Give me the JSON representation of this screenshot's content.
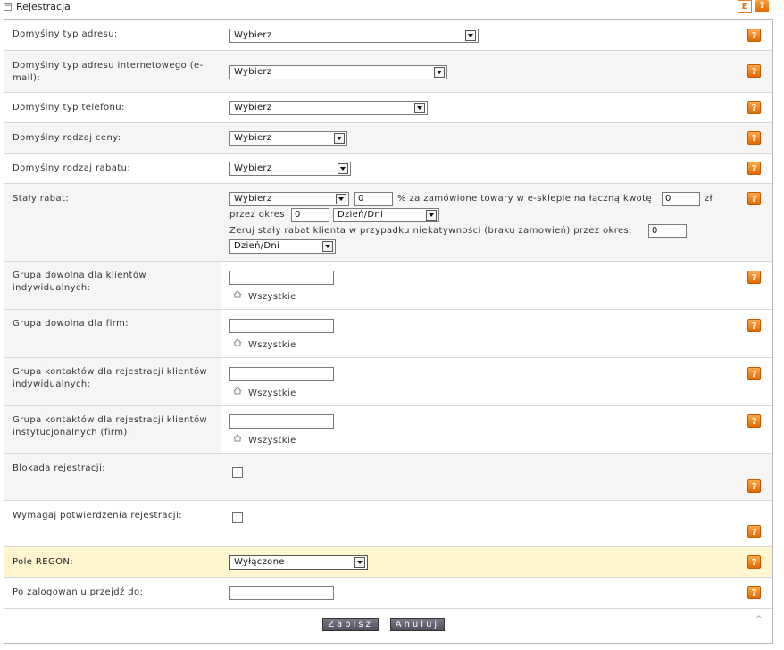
{
  "header": {
    "collapse_symbol": "−",
    "title": "Rejestracja",
    "e_icon": "E",
    "help_icon": "?"
  },
  "help_symbol": "?",
  "rows": {
    "address_type": {
      "label": "Domyślny typ adresu:",
      "value": "Wybierz"
    },
    "email_type": {
      "label": "Domyślny typ adresu internetowego (e-mail):",
      "value": "Wybierz"
    },
    "phone_type": {
      "label": "Domyślny typ telefonu:",
      "value": "Wybierz"
    },
    "price_type": {
      "label": "Domyślny rodzaj ceny:",
      "value": "Wybierz"
    },
    "discount_type": {
      "label": "Domyślny rodzaj rabatu:",
      "value": "Wybierz"
    },
    "fixed_discount": {
      "label": "Stały rabat:",
      "select_value": "Wybierz",
      "percent_value": "0",
      "percent_text": "% za zamówione towary w e-sklepie na łączną kwotę",
      "amount_value": "0",
      "currency": "zł",
      "period_text": "przez okres",
      "period_value": "0",
      "period_unit": "Dzień/Dni",
      "reset_text": "Zeruj stały rabat klienta w przypadku niekatywności (braku zamowień) przez okres:",
      "reset_value": "0",
      "reset_unit": "Dzień/Dni"
    },
    "group_individual": {
      "label": "Grupa dowolna dla klientów indywidualnych:",
      "link": "Wszystkie"
    },
    "group_companies": {
      "label": "Grupa dowolna dla firm:",
      "link": "Wszystkie"
    },
    "contacts_individual": {
      "label": "Grupa kontaktów dla rejestracji klientów indywidualnych:",
      "link": "Wszystkie"
    },
    "contacts_institutional": {
      "label": "Grupa kontaktów dla rejestracji klientów instytucjonalnych (firm):",
      "link": "Wszystkie"
    },
    "block_registration": {
      "label": "Blokada rejestracji:",
      "checked": false
    },
    "require_confirmation": {
      "label": "Wymagaj potwierdzenia rejestracji:",
      "checked": false
    },
    "regon": {
      "label": "Pole REGON:",
      "value": "Wyłączone"
    },
    "after_login": {
      "label": "Po zalogowaniu przejdź do:",
      "value": ""
    }
  },
  "buttons": {
    "save": "Zapisz",
    "cancel": "Anuluj"
  },
  "scroll_top_symbol": "^",
  "colors": {
    "help_orange": "#e26a00",
    "highlight_row": "#fff5cf",
    "alt_row": "#f6f5f3"
  }
}
